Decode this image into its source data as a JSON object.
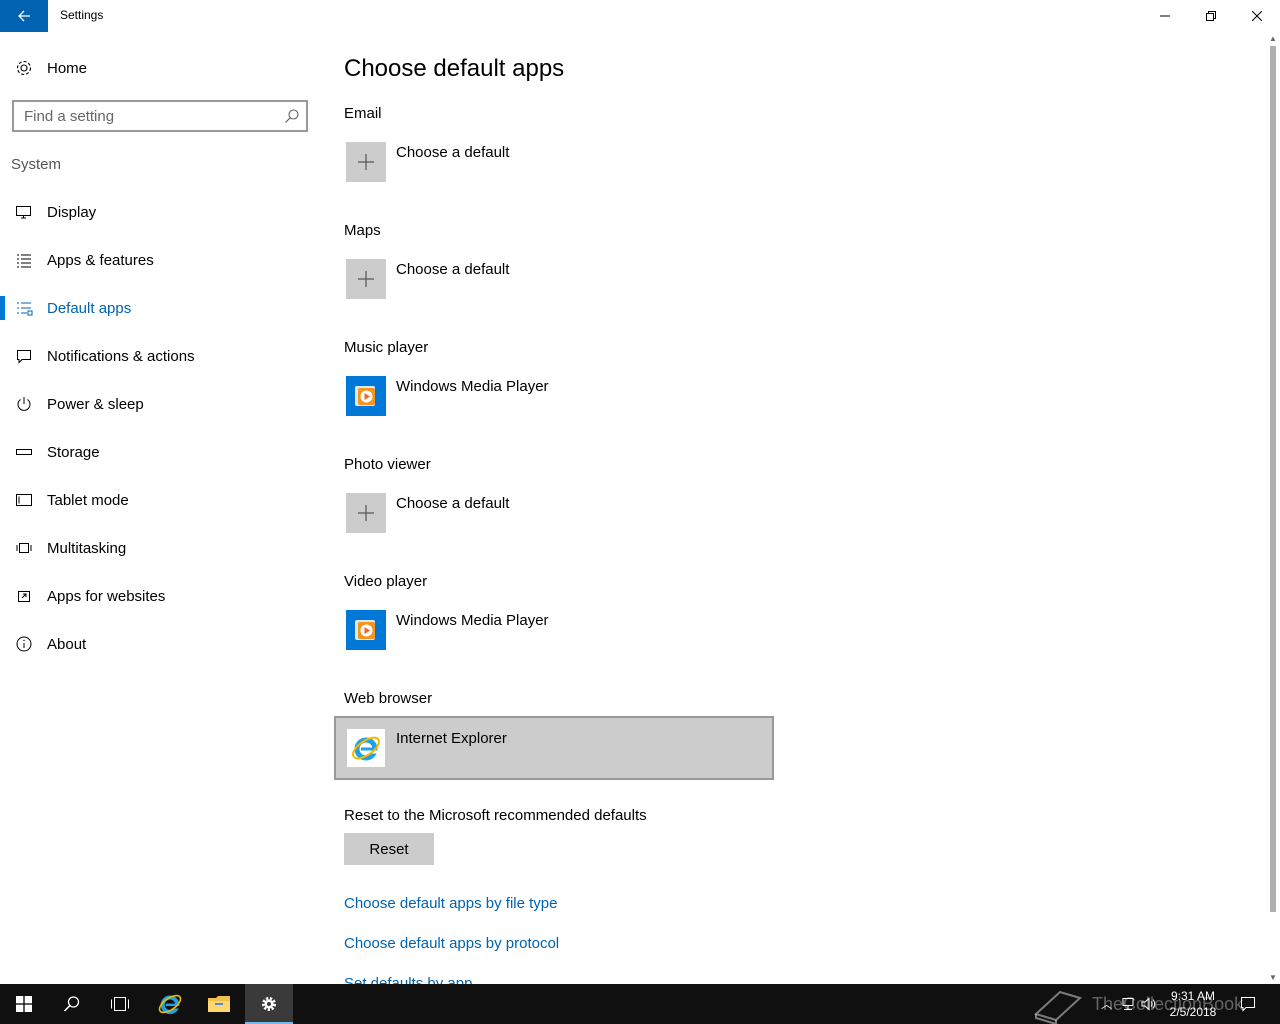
{
  "window": {
    "title": "Settings",
    "controls": {
      "minimize": "minimize",
      "maximize": "restore",
      "close": "close"
    }
  },
  "sidebar": {
    "home_label": "Home",
    "search_placeholder": "Find a setting",
    "section_label": "System",
    "items": [
      {
        "label": "Display",
        "icon": "monitor-icon"
      },
      {
        "label": "Apps & features",
        "icon": "list-icon"
      },
      {
        "label": "Default apps",
        "icon": "default-apps-icon",
        "selected": true
      },
      {
        "label": "Notifications & actions",
        "icon": "message-icon"
      },
      {
        "label": "Power & sleep",
        "icon": "power-icon"
      },
      {
        "label": "Storage",
        "icon": "storage-icon"
      },
      {
        "label": "Tablet mode",
        "icon": "tablet-icon"
      },
      {
        "label": "Multitasking",
        "icon": "multitasking-icon"
      },
      {
        "label": "Apps for websites",
        "icon": "open-in-app-icon"
      },
      {
        "label": "About",
        "icon": "info-icon"
      }
    ]
  },
  "main": {
    "title": "Choose default apps",
    "categories": [
      {
        "label": "Email",
        "app": "Choose a default",
        "tile": "plus-icon"
      },
      {
        "label": "Maps",
        "app": "Choose a default",
        "tile": "plus-icon"
      },
      {
        "label": "Music player",
        "app": "Windows Media Player",
        "tile": "windows-media-player-icon"
      },
      {
        "label": "Photo viewer",
        "app": "Choose a default",
        "tile": "plus-icon"
      },
      {
        "label": "Video player",
        "app": "Windows Media Player",
        "tile": "windows-media-player-icon"
      },
      {
        "label": "Web browser",
        "app": "Internet Explorer",
        "tile": "internet-explorer-icon",
        "focused": true
      }
    ],
    "reset_label": "Reset to the Microsoft recommended defaults",
    "reset_button": "Reset",
    "links": [
      "Choose default apps by file type",
      "Choose default apps by protocol",
      "Set defaults by app"
    ]
  },
  "taskbar": {
    "time": "9:31 AM",
    "date": "2/5/2018",
    "watermark": "TheCollectionBook",
    "accent": "#76b9ed"
  },
  "colors": {
    "accent": "#0078d7",
    "link": "#0063b1",
    "tile_gray": "#cccccc",
    "taskbar": "#101010"
  }
}
